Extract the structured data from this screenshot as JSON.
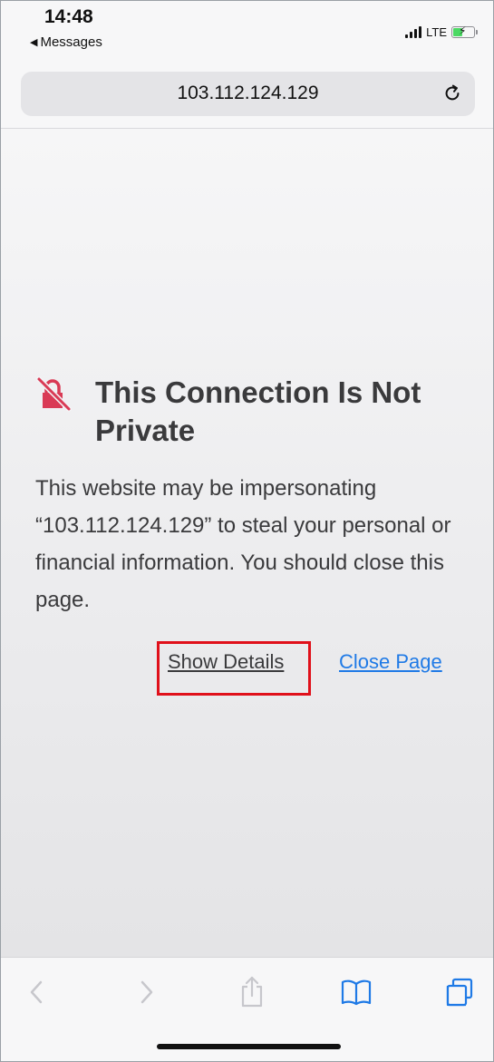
{
  "status_bar": {
    "time": "14:48",
    "back_app": "Messages",
    "network": "LTE"
  },
  "browser": {
    "url": "103.112.124.129"
  },
  "warning": {
    "title": "This Connection Is Not Private",
    "message": "This website may be impersonating “103.112.124.129” to steal your personal or financial information. You should close this page.",
    "show_details_label": "Show Details",
    "close_page_label": "Close Page"
  },
  "colors": {
    "warning_icon": "#d93a55",
    "link": "#1f7ae6",
    "highlight_box": "#e0101a",
    "toolbar_active_icon": "#1f7ae6",
    "toolbar_disabled_icon": "#c7c7cc"
  },
  "icons": {
    "back": "chevron-left-icon",
    "forward": "chevron-right-icon",
    "share": "share-icon",
    "bookmarks": "book-icon",
    "tabs": "tabs-icon",
    "reload": "reload-icon",
    "warning": "unlocked-warning-icon"
  }
}
